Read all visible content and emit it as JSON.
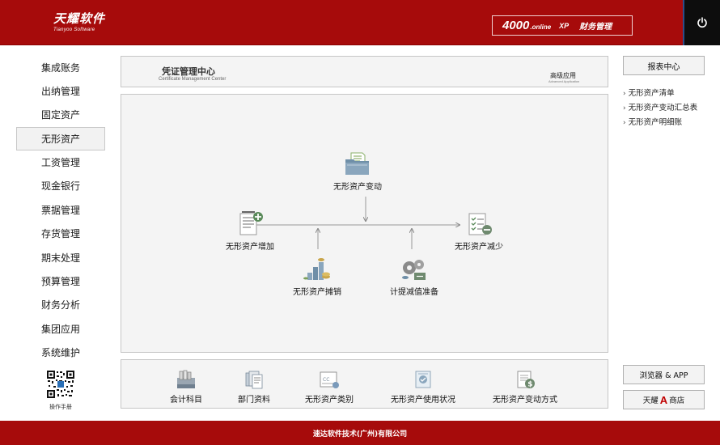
{
  "header": {
    "logo_cn": "天耀软件",
    "logo_en": "Tianyoo Software",
    "product_big": "4000",
    "product_small": ".online",
    "product_xp": "XP",
    "product_name": "财务管理",
    "power_icon": "power-icon"
  },
  "sidebar": {
    "items": [
      {
        "label": "集成账务"
      },
      {
        "label": "出纳管理"
      },
      {
        "label": "固定资产"
      },
      {
        "label": "无形资产",
        "active": true
      },
      {
        "label": "工资管理"
      },
      {
        "label": "现金银行"
      },
      {
        "label": "票据管理"
      },
      {
        "label": "存货管理"
      },
      {
        "label": "期末处理"
      },
      {
        "label": "预算管理"
      },
      {
        "label": "财务分析"
      },
      {
        "label": "集团应用"
      },
      {
        "label": "系统维护"
      }
    ],
    "manual_label": "操作手册"
  },
  "title_panel": {
    "title_cn": "凭证管理中心",
    "title_en": "Certificate Management Center",
    "advanced_cn": "高级应用",
    "advanced_en": "Advanced Application"
  },
  "flow": {
    "change": "无形资产变动",
    "increase": "无形资产增加",
    "decrease": "无形资产减少",
    "amortize": "无形资产摊销",
    "impairment": "计提减值准备"
  },
  "tools": [
    {
      "label": "会计科目",
      "icon": "ledger-icon"
    },
    {
      "label": "部门资料",
      "icon": "department-docs-icon"
    },
    {
      "label": "无形资产类别",
      "icon": "category-icon"
    },
    {
      "label": "无形资产使用状况",
      "icon": "usage-status-icon"
    },
    {
      "label": "无形资产变动方式",
      "icon": "change-method-icon"
    }
  ],
  "right": {
    "report_center": "报表中心",
    "links": [
      {
        "label": "无形资产清单"
      },
      {
        "label": "无形资产变动汇总表"
      },
      {
        "label": "无形资产明细账"
      }
    ],
    "browser_app": "浏览器 & APP",
    "store_prefix": "天耀",
    "store_logo": "A",
    "store_suffix": "商店"
  },
  "footer": {
    "company": "速达软件技术(广州)有限公司"
  },
  "colors": {
    "brand_red": "#a60b0b",
    "panel_bg": "#f4f4f4",
    "panel_border": "#c6c6c6"
  }
}
